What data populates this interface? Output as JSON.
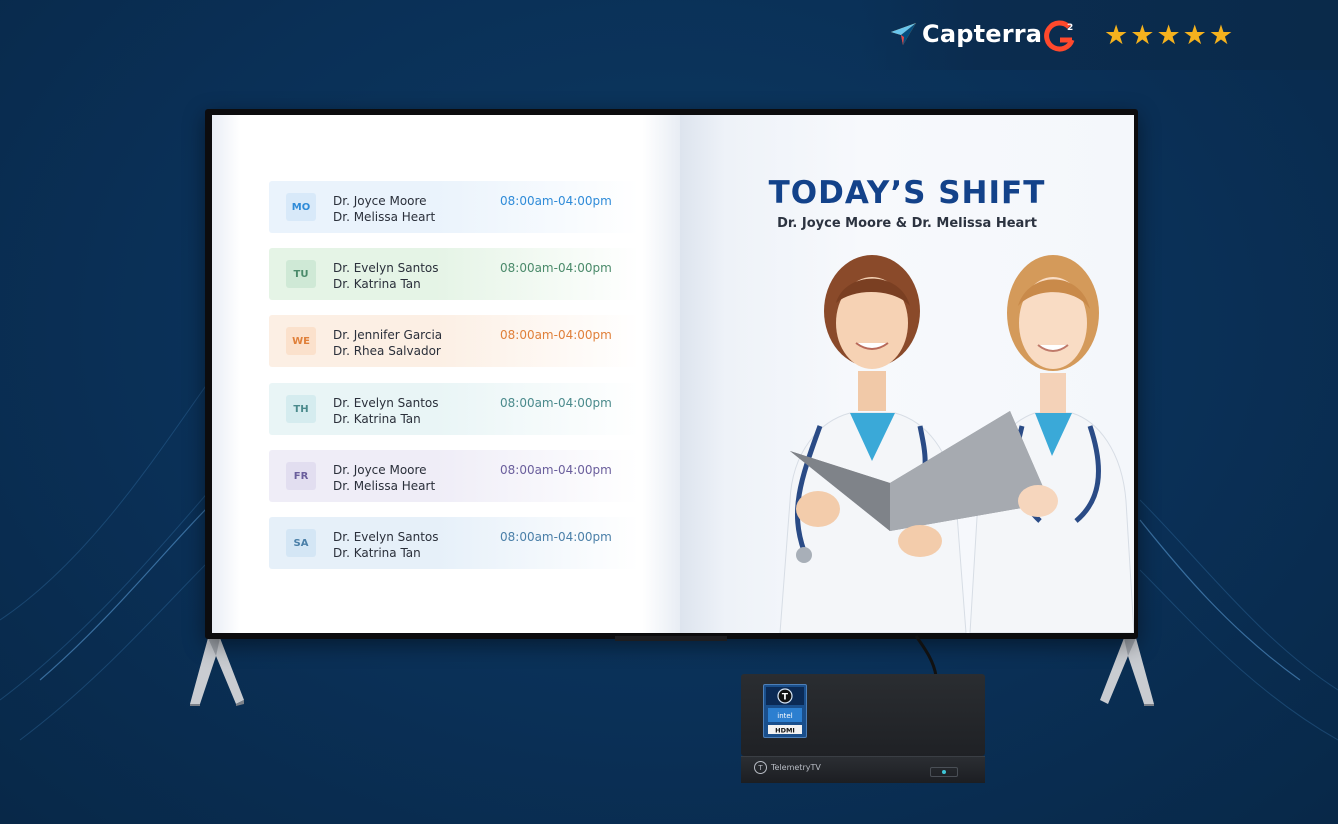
{
  "header": {
    "capterra_label": "Capterra",
    "g2_label": "G2",
    "rating_stars": 5,
    "stars": [
      "★",
      "★",
      "★",
      "★",
      "★"
    ],
    "star_color": "#f5b21e"
  },
  "schedule": {
    "rows": [
      {
        "day": "MO",
        "doctor1": "Dr. Joyce Moore",
        "doctor2": "Dr. Melissa Heart",
        "time": "08:00am-04:00pm",
        "accent": "#2f8bd8",
        "badge_bg": "#d8e9f9",
        "row_bg": "#eaf3fc"
      },
      {
        "day": "TU",
        "doctor1": "Dr. Evelyn Santos",
        "doctor2": "Dr. Katrina Tan",
        "time": "08:00am-04:00pm",
        "accent": "#4a8a6a",
        "badge_bg": "#cfe9d6",
        "row_bg": "#e5f4e6"
      },
      {
        "day": "WE",
        "doctor1": "Dr. Jennifer Garcia",
        "doctor2": "Dr. Rhea Salvador",
        "time": "08:00am-04:00pm",
        "accent": "#e0803a",
        "badge_bg": "#fbe1cc",
        "row_bg": "#fcefe4"
      },
      {
        "day": "TH",
        "doctor1": "Dr. Evelyn Santos",
        "doctor2": "Dr. Katrina Tan",
        "time": "08:00am-04:00pm",
        "accent": "#4a8a8c",
        "badge_bg": "#d5ecef",
        "row_bg": "#e9f5f6"
      },
      {
        "day": "FR",
        "doctor1": "Dr. Joyce Moore",
        "doctor2": "Dr. Melissa Heart",
        "time": "08:00am-04:00pm",
        "accent": "#6a5e9c",
        "badge_bg": "#e2def0",
        "row_bg": "#efedf7"
      },
      {
        "day": "SA",
        "doctor1": "Dr. Evelyn Santos",
        "doctor2": "Dr. Katrina Tan",
        "time": "08:00am-04:00pm",
        "accent": "#4a7fa8",
        "badge_bg": "#d4e6f5",
        "row_bg": "#e6f0f9"
      }
    ]
  },
  "today": {
    "title": "TODAY’S SHIFT",
    "subtitle": "Dr. Joyce Moore & Dr. Melissa Heart"
  },
  "device": {
    "brand": "TelemetryTV",
    "sticker_brand": "intel",
    "sticker_port": "HDMI"
  },
  "colors": {
    "background": "#0a3057",
    "title_blue": "#13428a"
  }
}
